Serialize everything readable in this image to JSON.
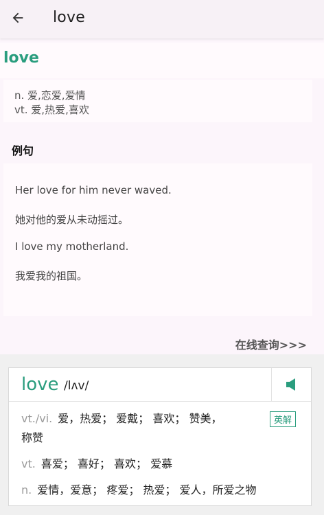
{
  "appbar": {
    "title": "love",
    "back_icon": "arrow-left-icon"
  },
  "word": {
    "headword": "love",
    "definitions": [
      "n. 爱,恋爱,爱情",
      "vt. 爱,热爱,喜欢"
    ]
  },
  "examples": {
    "title": "例句",
    "items": [
      "Her love for him never waved.",
      "她对他的爱从未动摇过。",
      "I love my motherland.",
      "我爱我的祖国。"
    ]
  },
  "online_link": "在线查询>>>",
  "popup": {
    "word": "love",
    "phonetic": "/lʌv/",
    "speaker_icon": "speaker-icon",
    "badge": "英解",
    "senses": [
      {
        "pos": "vt./vi.",
        "text": "爱，热爱； 爱戴； 喜欢； 赞美，",
        "cont": "称赞"
      },
      {
        "pos": "vt.",
        "text": "喜爱； 喜好； 喜欢； 爱慕"
      },
      {
        "pos": "n.",
        "text": "爱情，爱意； 疼爱； 热爱； 爱人，所爱之物"
      }
    ]
  },
  "colors": {
    "accent": "#2a9d7e",
    "page_bg": "#fcf5fb",
    "card_bg": "#fffafd"
  }
}
